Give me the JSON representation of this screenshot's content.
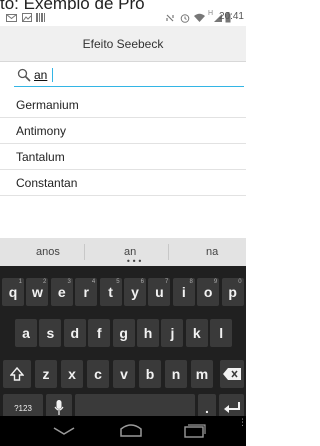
{
  "top_text": "to: Exemplo de Pro",
  "status": {
    "time": "20:41",
    "network": "H"
  },
  "title": "Efeito Seebeck",
  "search": {
    "value": "an"
  },
  "results": [
    "Germanium",
    "Antimony",
    "Tantalum",
    "Constantan"
  ],
  "keyboard": {
    "suggestions": [
      "anos",
      "an",
      "na"
    ],
    "row1": [
      {
        "k": "q",
        "h": "1"
      },
      {
        "k": "w",
        "h": "2"
      },
      {
        "k": "e",
        "h": "3"
      },
      {
        "k": "r",
        "h": "4"
      },
      {
        "k": "t",
        "h": "5"
      },
      {
        "k": "y",
        "h": "6"
      },
      {
        "k": "u",
        "h": "7"
      },
      {
        "k": "i",
        "h": "8"
      },
      {
        "k": "o",
        "h": "9"
      },
      {
        "k": "p",
        "h": "0"
      }
    ],
    "row2": [
      "a",
      "s",
      "d",
      "f",
      "g",
      "h",
      "j",
      "k",
      "l"
    ],
    "row3": [
      "z",
      "x",
      "c",
      "v",
      "b",
      "n",
      "m"
    ],
    "symbols_label": "?123",
    "period_label": "."
  },
  "icons": [
    "email-icon",
    "image-icon",
    "barcode-icon",
    "rotate-icon",
    "alarm-icon",
    "wifi-icon",
    "signal-icon",
    "battery-icon",
    "mic-icon",
    "shift-icon",
    "backspace-icon",
    "enter-icon",
    "back-icon",
    "home-icon",
    "recent-apps-icon"
  ]
}
